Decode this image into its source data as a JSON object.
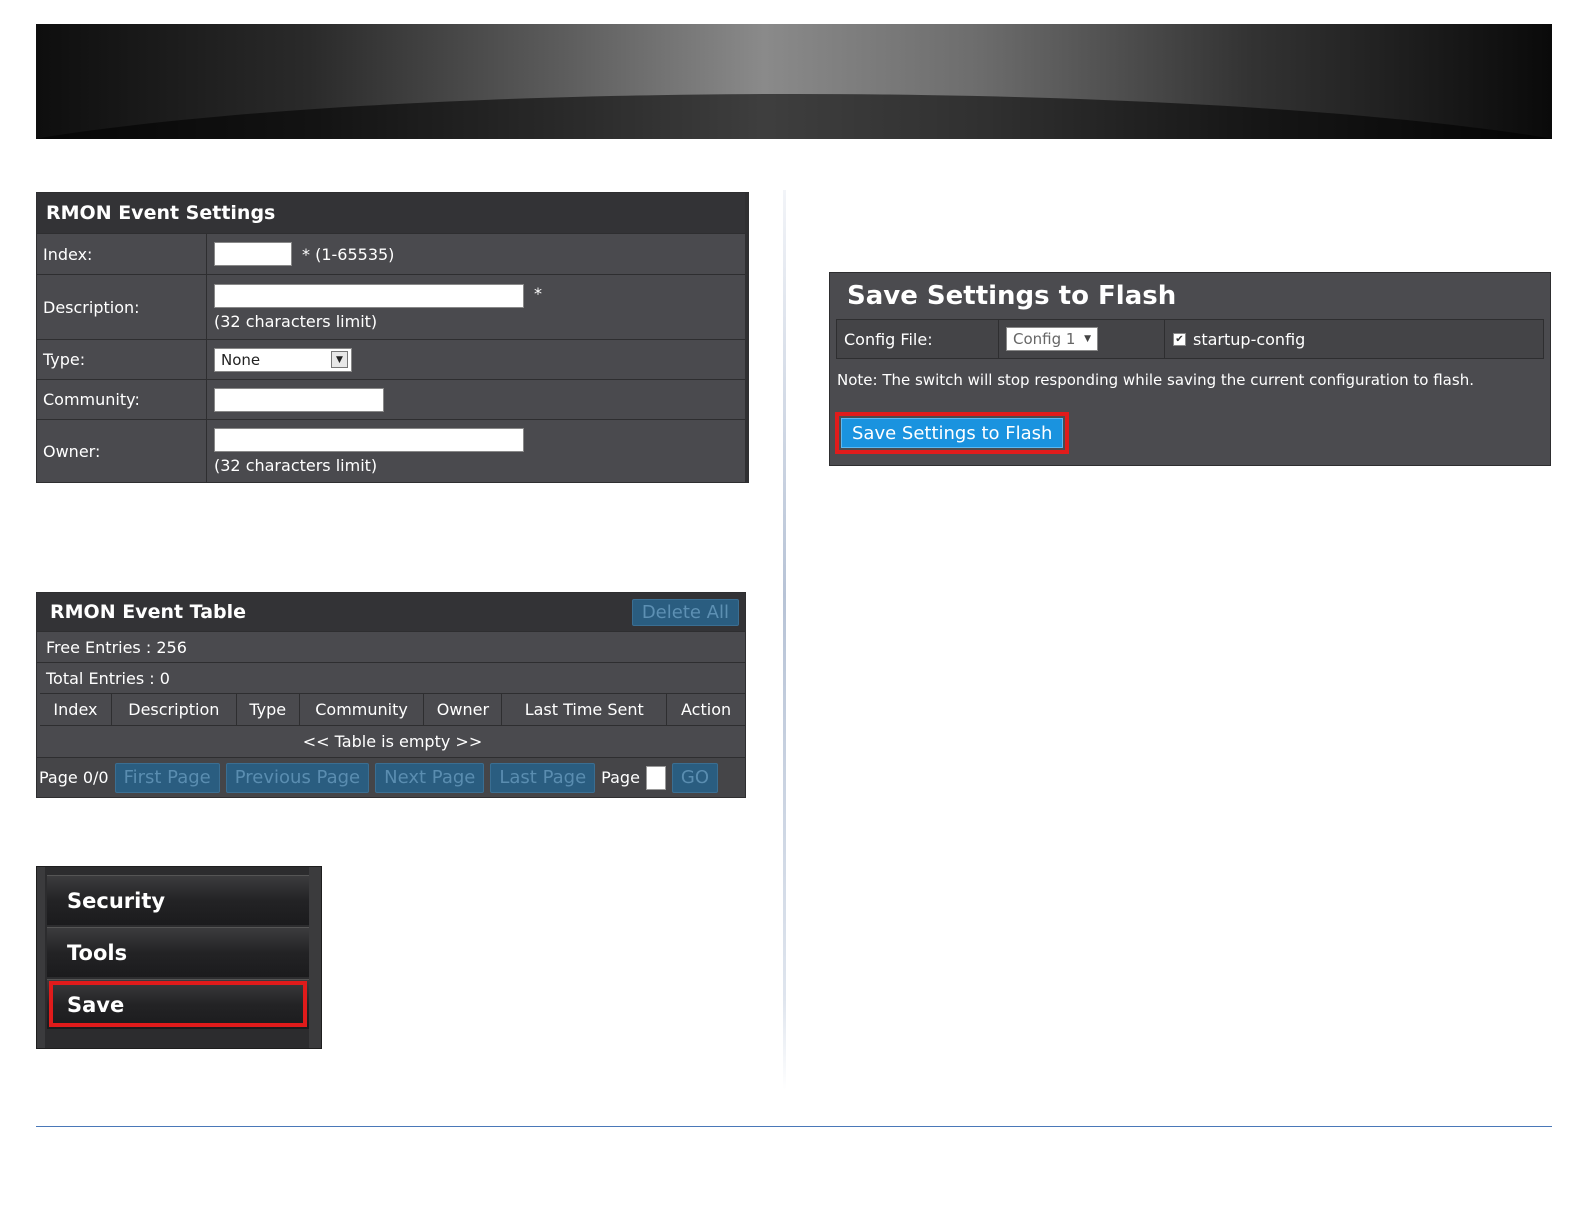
{
  "settings": {
    "title": "RMON Event Settings",
    "index_label": "Index:",
    "index_hint": "* (1-65535)",
    "description_label": "Description:",
    "description_req": "*",
    "description_hint": "(32 characters limit)",
    "type_label": "Type:",
    "type_value": "None",
    "community_label": "Community:",
    "owner_label": "Owner:",
    "owner_hint": "(32 characters limit)"
  },
  "table": {
    "title": "RMON Event Table",
    "delete_all": "Delete All",
    "free_entries": "Free Entries : 256",
    "total_entries": "Total Entries : 0",
    "columns": [
      "Index",
      "Description",
      "Type",
      "Community",
      "Owner",
      "Last Time Sent",
      "Action"
    ],
    "empty": "<< Table is empty >>",
    "pager": {
      "page_info": "Page 0/0",
      "first": "First Page",
      "previous": "Previous Page",
      "next": "Next Page",
      "last": "Last Page",
      "page_label": "Page",
      "go": "GO"
    }
  },
  "menu": {
    "items": [
      "Security",
      "Tools",
      "Save"
    ],
    "highlight_color": "#e01b1b"
  },
  "flash": {
    "title": "Save Settings to Flash",
    "config_label": "Config File:",
    "config_value": "Config 1",
    "checkbox_label": "startup-config",
    "note": "Note: The switch will stop responding while saving the current configuration to flash.",
    "button": "Save Settings to Flash",
    "button_color": "#1a93df"
  }
}
